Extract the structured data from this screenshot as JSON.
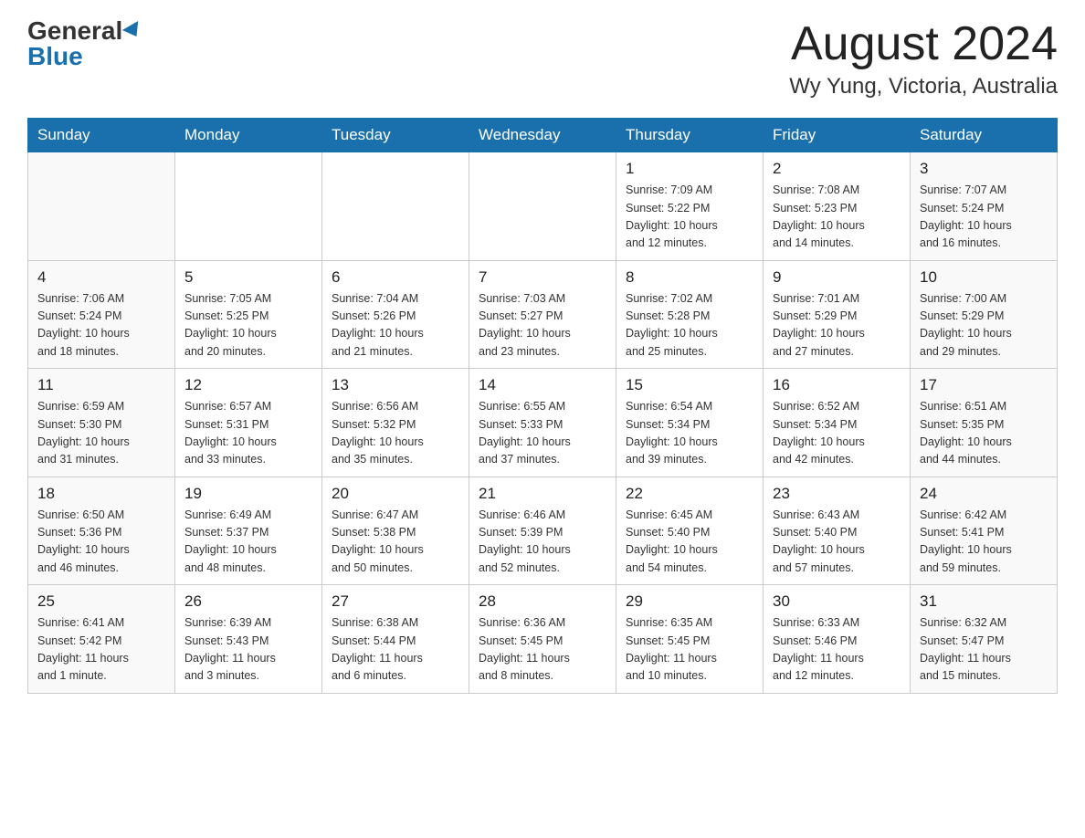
{
  "header": {
    "logo_general": "General",
    "logo_blue": "Blue",
    "month_title": "August 2024",
    "location": "Wy Yung, Victoria, Australia"
  },
  "days_of_week": [
    "Sunday",
    "Monday",
    "Tuesday",
    "Wednesday",
    "Thursday",
    "Friday",
    "Saturday"
  ],
  "weeks": [
    [
      {
        "day": "",
        "info": ""
      },
      {
        "day": "",
        "info": ""
      },
      {
        "day": "",
        "info": ""
      },
      {
        "day": "",
        "info": ""
      },
      {
        "day": "1",
        "info": "Sunrise: 7:09 AM\nSunset: 5:22 PM\nDaylight: 10 hours\nand 12 minutes."
      },
      {
        "day": "2",
        "info": "Sunrise: 7:08 AM\nSunset: 5:23 PM\nDaylight: 10 hours\nand 14 minutes."
      },
      {
        "day": "3",
        "info": "Sunrise: 7:07 AM\nSunset: 5:24 PM\nDaylight: 10 hours\nand 16 minutes."
      }
    ],
    [
      {
        "day": "4",
        "info": "Sunrise: 7:06 AM\nSunset: 5:24 PM\nDaylight: 10 hours\nand 18 minutes."
      },
      {
        "day": "5",
        "info": "Sunrise: 7:05 AM\nSunset: 5:25 PM\nDaylight: 10 hours\nand 20 minutes."
      },
      {
        "day": "6",
        "info": "Sunrise: 7:04 AM\nSunset: 5:26 PM\nDaylight: 10 hours\nand 21 minutes."
      },
      {
        "day": "7",
        "info": "Sunrise: 7:03 AM\nSunset: 5:27 PM\nDaylight: 10 hours\nand 23 minutes."
      },
      {
        "day": "8",
        "info": "Sunrise: 7:02 AM\nSunset: 5:28 PM\nDaylight: 10 hours\nand 25 minutes."
      },
      {
        "day": "9",
        "info": "Sunrise: 7:01 AM\nSunset: 5:29 PM\nDaylight: 10 hours\nand 27 minutes."
      },
      {
        "day": "10",
        "info": "Sunrise: 7:00 AM\nSunset: 5:29 PM\nDaylight: 10 hours\nand 29 minutes."
      }
    ],
    [
      {
        "day": "11",
        "info": "Sunrise: 6:59 AM\nSunset: 5:30 PM\nDaylight: 10 hours\nand 31 minutes."
      },
      {
        "day": "12",
        "info": "Sunrise: 6:57 AM\nSunset: 5:31 PM\nDaylight: 10 hours\nand 33 minutes."
      },
      {
        "day": "13",
        "info": "Sunrise: 6:56 AM\nSunset: 5:32 PM\nDaylight: 10 hours\nand 35 minutes."
      },
      {
        "day": "14",
        "info": "Sunrise: 6:55 AM\nSunset: 5:33 PM\nDaylight: 10 hours\nand 37 minutes."
      },
      {
        "day": "15",
        "info": "Sunrise: 6:54 AM\nSunset: 5:34 PM\nDaylight: 10 hours\nand 39 minutes."
      },
      {
        "day": "16",
        "info": "Sunrise: 6:52 AM\nSunset: 5:34 PM\nDaylight: 10 hours\nand 42 minutes."
      },
      {
        "day": "17",
        "info": "Sunrise: 6:51 AM\nSunset: 5:35 PM\nDaylight: 10 hours\nand 44 minutes."
      }
    ],
    [
      {
        "day": "18",
        "info": "Sunrise: 6:50 AM\nSunset: 5:36 PM\nDaylight: 10 hours\nand 46 minutes."
      },
      {
        "day": "19",
        "info": "Sunrise: 6:49 AM\nSunset: 5:37 PM\nDaylight: 10 hours\nand 48 minutes."
      },
      {
        "day": "20",
        "info": "Sunrise: 6:47 AM\nSunset: 5:38 PM\nDaylight: 10 hours\nand 50 minutes."
      },
      {
        "day": "21",
        "info": "Sunrise: 6:46 AM\nSunset: 5:39 PM\nDaylight: 10 hours\nand 52 minutes."
      },
      {
        "day": "22",
        "info": "Sunrise: 6:45 AM\nSunset: 5:40 PM\nDaylight: 10 hours\nand 54 minutes."
      },
      {
        "day": "23",
        "info": "Sunrise: 6:43 AM\nSunset: 5:40 PM\nDaylight: 10 hours\nand 57 minutes."
      },
      {
        "day": "24",
        "info": "Sunrise: 6:42 AM\nSunset: 5:41 PM\nDaylight: 10 hours\nand 59 minutes."
      }
    ],
    [
      {
        "day": "25",
        "info": "Sunrise: 6:41 AM\nSunset: 5:42 PM\nDaylight: 11 hours\nand 1 minute."
      },
      {
        "day": "26",
        "info": "Sunrise: 6:39 AM\nSunset: 5:43 PM\nDaylight: 11 hours\nand 3 minutes."
      },
      {
        "day": "27",
        "info": "Sunrise: 6:38 AM\nSunset: 5:44 PM\nDaylight: 11 hours\nand 6 minutes."
      },
      {
        "day": "28",
        "info": "Sunrise: 6:36 AM\nSunset: 5:45 PM\nDaylight: 11 hours\nand 8 minutes."
      },
      {
        "day": "29",
        "info": "Sunrise: 6:35 AM\nSunset: 5:45 PM\nDaylight: 11 hours\nand 10 minutes."
      },
      {
        "day": "30",
        "info": "Sunrise: 6:33 AM\nSunset: 5:46 PM\nDaylight: 11 hours\nand 12 minutes."
      },
      {
        "day": "31",
        "info": "Sunrise: 6:32 AM\nSunset: 5:47 PM\nDaylight: 11 hours\nand 15 minutes."
      }
    ]
  ]
}
